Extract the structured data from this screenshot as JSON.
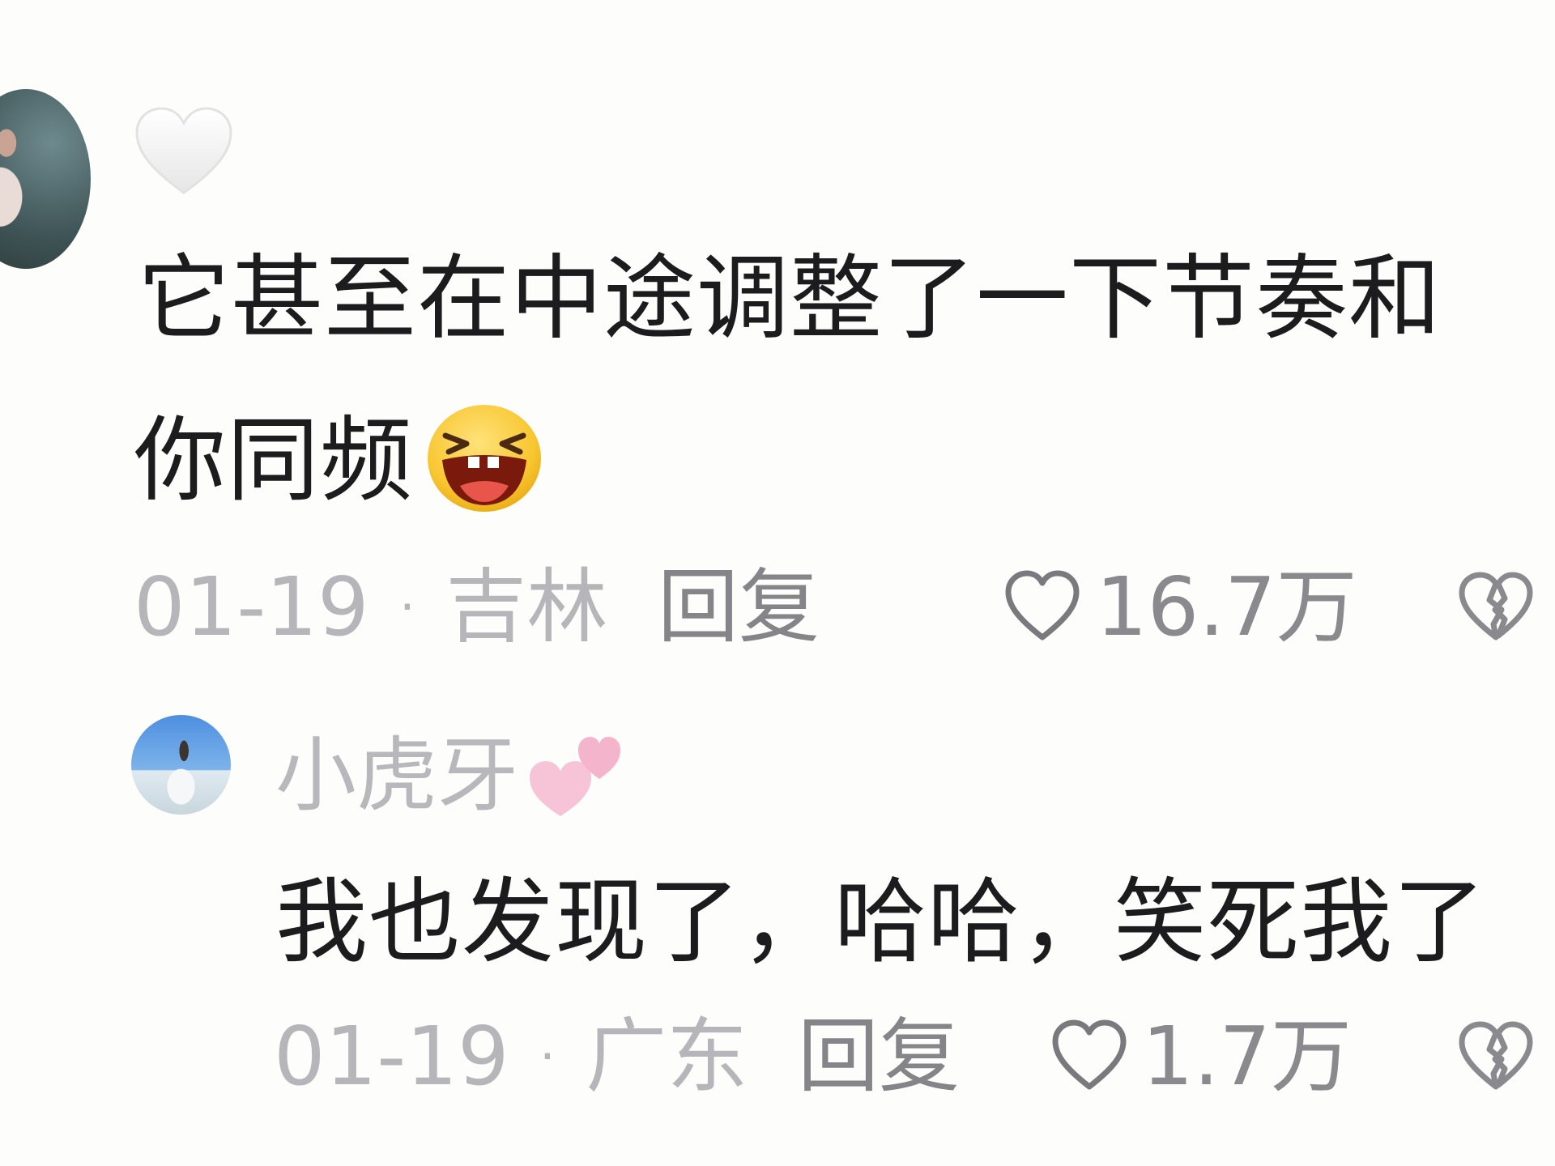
{
  "comment": {
    "text_line1": "它甚至在中途调整了一下节奏和",
    "text_line2": "你同频",
    "date": "01-19",
    "separator": "·",
    "location": "吉林",
    "reply_label": "回复",
    "like_count": "16.7万",
    "emoji": "laughing-emoji",
    "badge_icon": "white-heart-icon"
  },
  "reply": {
    "username": "小虎牙",
    "username_icon": "two-hearts-icon",
    "text": "我也发现了，哈哈，笑死我了",
    "date": "01-19",
    "separator": "·",
    "location": "广东",
    "reply_label": "回复",
    "like_count": "1.7万"
  },
  "icons": {
    "like": "heart-outline-icon",
    "dislike": "broken-heart-icon"
  },
  "colors": {
    "text_primary": "#1c1c1e",
    "text_meta": "#b6b6ba",
    "text_action": "#858589",
    "background": "#fdfdfc"
  }
}
